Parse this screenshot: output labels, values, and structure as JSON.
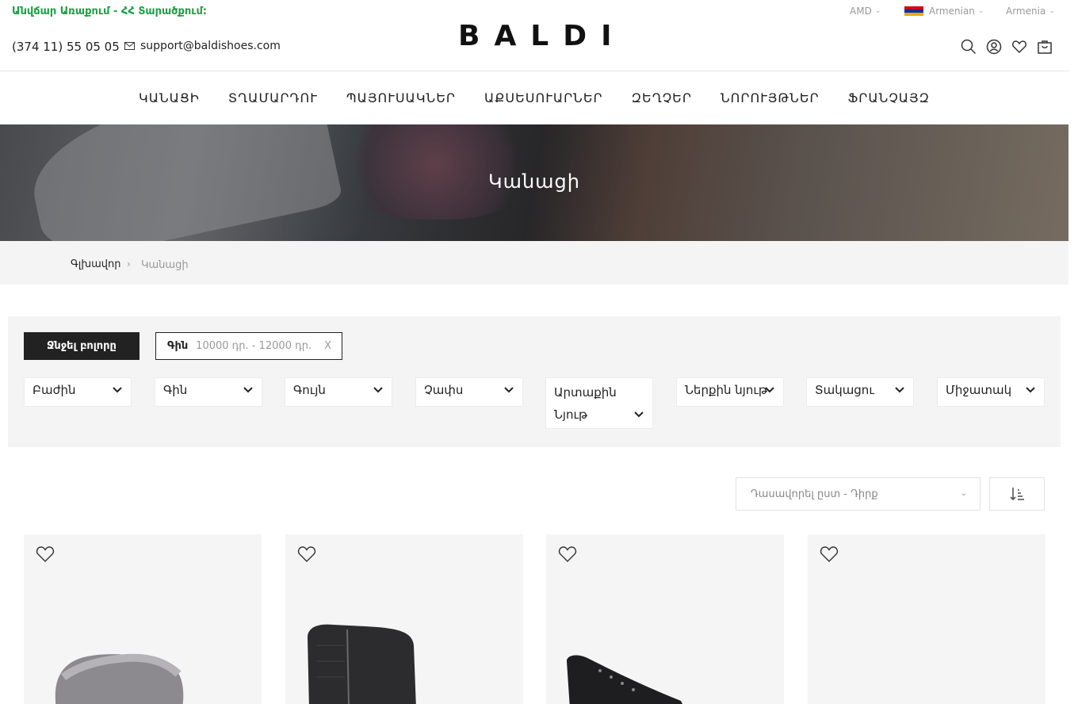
{
  "header": {
    "promo": "Անվճար Առաքում - ՀՀ Տարածքում:",
    "phone": "(374 11) 55 05 05",
    "email": "support@baldishoes.com",
    "logo": "BALDI",
    "currency": "AMD",
    "language": "Armenian",
    "country": "Armenia"
  },
  "nav": {
    "items": [
      "ԿԱՆԱՑԻ",
      "ՏՂԱՄԱՐԴՈՒ",
      "ՊԱՅՈՒՍԱԿՆԵՐ",
      "ԱՔՍԵՍՈՒԱՐՆԵՐ",
      "ԶԵՂՉԵՐ",
      "ՆՈՐՈՒՅԹՆԵՐ",
      "ՖՐԱՆՉԱՅԶ"
    ]
  },
  "hero": {
    "title": "Կանացի"
  },
  "breadcrumb": {
    "home": "Գլխավոր",
    "current": "Կանացի"
  },
  "filters": {
    "clear_label": "Ջնջել բոլորը",
    "active_chip": {
      "key": "Գին",
      "value": "10000 դր. - 12000 դր.",
      "remove": "X"
    },
    "dropdowns": [
      "Բաժին",
      "Գին",
      "Գույն",
      "Չափս",
      "Արտաքին Նյութ",
      "Ներքին նյութ",
      "Տակացու",
      "Միջատակ"
    ]
  },
  "sort": {
    "label": "Դասավորել ըստ - Դիրք"
  },
  "products": [
    {
      "name": "fur-boot"
    },
    {
      "name": "croc-ankle-boot"
    },
    {
      "name": "black-lace-boot"
    },
    {
      "name": "empty"
    }
  ],
  "colors": {
    "promo": "#19a045",
    "dark": "#222222",
    "panel": "#f4f4f4"
  }
}
